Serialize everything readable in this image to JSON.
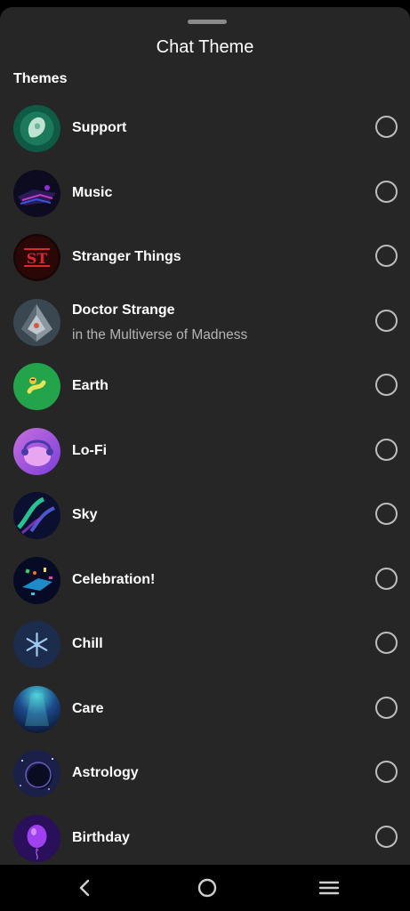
{
  "sheet": {
    "title": "Chat Theme",
    "section_label": "Themes"
  },
  "themes": [
    {
      "name": "Support",
      "subtitle": "",
      "icon": "support-theme-icon",
      "selected": false
    },
    {
      "name": "Music",
      "subtitle": "",
      "icon": "music-theme-icon",
      "selected": false
    },
    {
      "name": "Stranger Things",
      "subtitle": "",
      "icon": "stranger-things-theme-icon",
      "selected": false
    },
    {
      "name": "Doctor Strange",
      "subtitle": "in the Multiverse of Madness",
      "icon": "doctor-strange-theme-icon",
      "selected": false
    },
    {
      "name": "Earth",
      "subtitle": "",
      "icon": "earth-theme-icon",
      "selected": false
    },
    {
      "name": "Lo-Fi",
      "subtitle": "",
      "icon": "lofi-theme-icon",
      "selected": false
    },
    {
      "name": "Sky",
      "subtitle": "",
      "icon": "sky-theme-icon",
      "selected": false
    },
    {
      "name": "Celebration!",
      "subtitle": "",
      "icon": "celebration-theme-icon",
      "selected": false
    },
    {
      "name": "Chill",
      "subtitle": "",
      "icon": "chill-theme-icon",
      "selected": false
    },
    {
      "name": "Care",
      "subtitle": "",
      "icon": "care-theme-icon",
      "selected": false
    },
    {
      "name": "Astrology",
      "subtitle": "",
      "icon": "astrology-theme-icon",
      "selected": false
    },
    {
      "name": "Birthday",
      "subtitle": "",
      "icon": "birthday-theme-icon",
      "selected": false
    }
  ],
  "navbar": {
    "icons": [
      "back-icon",
      "home-icon",
      "recents-icon"
    ]
  },
  "colors": {
    "sheet_background": "#262626",
    "page_background": "#000000",
    "text_primary": "#ffffff",
    "text_secondary": "#b4b4b4",
    "radio_border": "#bdbdbd"
  }
}
